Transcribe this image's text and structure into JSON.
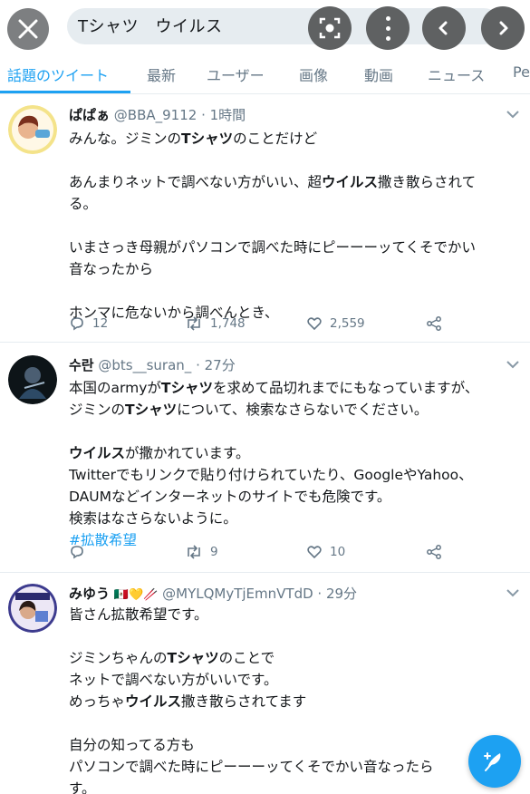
{
  "search": {
    "query": "Tシャツ　ウイルス"
  },
  "tabs": [
    "話題のツイート",
    "最新",
    "ユーザー",
    "画像",
    "動画",
    "ニュース",
    "Pe"
  ],
  "tweets": [
    {
      "name": "ぱぱぁ",
      "handle": "@BBA_9112",
      "time": "1時間",
      "lines": [
        [
          "みんな。ジミンの",
          "Tシャツ",
          "のことだけど"
        ],
        "",
        [
          "あんまりネットで調べない方がいい、超",
          "ウイルス",
          "撒き散らされて"
        ],
        [
          "る。"
        ],
        "",
        [
          "いまさっき母親がパソコンで調べた時にピーーーッてくそでかい"
        ],
        [
          "音なったから"
        ],
        "",
        [
          "ホンマに危ないから調べんとき、"
        ]
      ],
      "replies": "12",
      "retweets": "1,748",
      "likes": "2,559"
    },
    {
      "name": "수란",
      "handle": "@bts__suran_",
      "time": "27分",
      "lines": [
        [
          "本国のarmyが",
          "Tシャツ",
          "を求めて品切れまでにもなっていますが、"
        ],
        [
          "ジミンの",
          "Tシャツ",
          "について、検索なさらないでください。"
        ],
        "",
        [
          "",
          "ウイルス",
          "が撒かれています。"
        ],
        [
          "Twitterでもリンクで貼り付けられていたり、GoogleやYahoo、"
        ],
        [
          "DAUMなどインターネットのサイトでも危険です。"
        ],
        [
          "検索はなさらないように。"
        ]
      ],
      "hashtag": "#拡散希望",
      "replies": "",
      "retweets": "9",
      "likes": "10"
    },
    {
      "name": "みゆう",
      "emojis": "🇲🇽💛🥢",
      "handle": "@MYLQMyTjEmnVTdD",
      "time": "29分",
      "lines": [
        [
          "皆さん拡散希望です。"
        ],
        "",
        [
          "ジミンちゃんの",
          "Tシャツ",
          "のことで"
        ],
        [
          "ネットで調べない方がいいです。"
        ],
        [
          "めっちゃ",
          "ウイルス",
          "撒き散らされてます"
        ],
        "",
        [
          "自分の知ってる方も"
        ],
        [
          "パソコンで調べた時にピーーーッてくそでかい音なったら"
        ],
        [
          "す。"
        ]
      ]
    }
  ],
  "colors": {
    "accent": "#1da1f2",
    "muted": "#657786",
    "text": "#14171a"
  }
}
